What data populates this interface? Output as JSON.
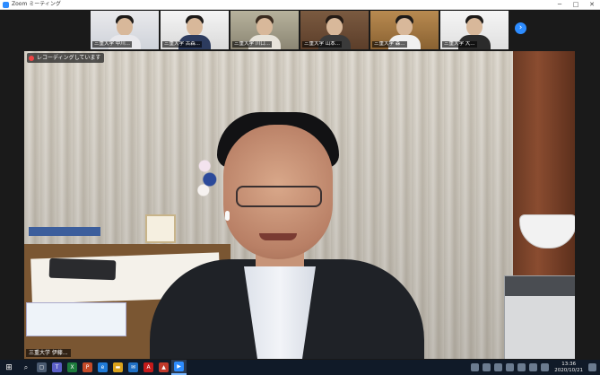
{
  "window": {
    "title": "Zoom ミーティング",
    "controls": [
      "─",
      "□",
      "✕"
    ]
  },
  "participants": [
    {
      "name": "三重大学 中川..."
    },
    {
      "name": "三重大学 古森..."
    },
    {
      "name": "三重大学 川口..."
    },
    {
      "name": "三重大学 山本..."
    },
    {
      "name": "三重大学 森..."
    },
    {
      "name": "三重大学 大..."
    }
  ],
  "main_video": {
    "recording_label": "レコーディングしています",
    "speaker_name": "三重大学 伊藤..."
  },
  "taskbar": {
    "start_icon": "windows-start-icon",
    "search_icon": "search-icon",
    "apps": [
      {
        "name": "task-view-icon",
        "glyph": "▢",
        "color": "#4a5a70"
      },
      {
        "name": "teams-icon",
        "glyph": "T",
        "color": "#5b5fc7"
      },
      {
        "name": "excel-icon",
        "glyph": "X",
        "color": "#1d7a3c"
      },
      {
        "name": "powerpoint-icon",
        "glyph": "P",
        "color": "#c44a28"
      },
      {
        "name": "edge-icon",
        "glyph": "e",
        "color": "#1f7ad6"
      },
      {
        "name": "file-explorer-icon",
        "glyph": "▬",
        "color": "#d9a21b"
      },
      {
        "name": "mail-icon",
        "glyph": "✉",
        "color": "#1f6fc4"
      },
      {
        "name": "acrobat-icon",
        "glyph": "A",
        "color": "#c41a1a"
      },
      {
        "name": "app-icon",
        "glyph": "▲",
        "color": "#c0392b"
      },
      {
        "name": "zoom-icon",
        "glyph": "▶",
        "color": "#2d8cff"
      }
    ],
    "clock_time": "13:36",
    "clock_date": "2020/10/21"
  }
}
